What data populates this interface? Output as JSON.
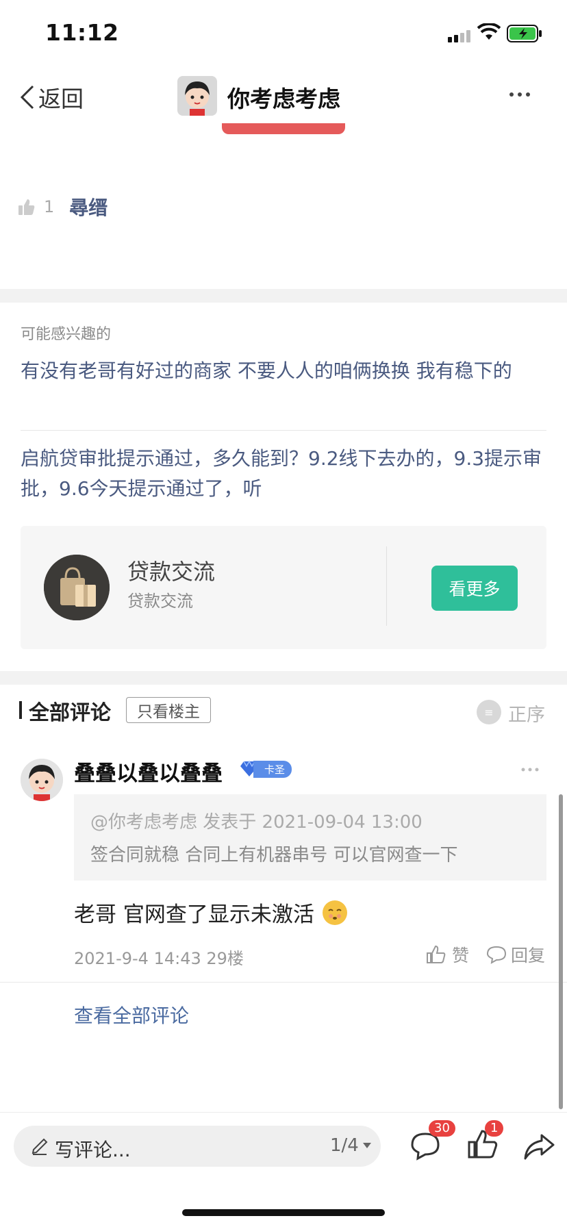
{
  "status_bar": {
    "time": "11:12"
  },
  "nav": {
    "back_label": "返回",
    "title": "你考虑考虑"
  },
  "likes": {
    "count": "1",
    "name": "尋缙"
  },
  "interest": {
    "label": "可能感兴趣的",
    "items": [
      "有没有老哥有好过的商家 不要人人的咱俩换换 我有稳下的",
      "启航贷审批提示通过，多久能到？9.2线下去办的，9.3提示审批，9.6今天提示通过了，听"
    ]
  },
  "group_card": {
    "name": "贷款交流",
    "subtitle": "贷款交流",
    "button": "看更多"
  },
  "comments": {
    "title": "全部评论",
    "only_owner": "只看楼主",
    "order_label": "正序",
    "item": {
      "name": "叠叠以叠以叠叠",
      "badge": "卡圣",
      "quote_header": "@你考虑考虑 发表于 2021-09-04 13:00",
      "quote_text": "签合同就稳 合同上有机器串号 可以官网查一下",
      "body": "老哥 官网查了显示未激活",
      "meta": "2021-9-4 14:43  29楼",
      "like_label": "赞",
      "reply_label": "回复"
    },
    "see_all": "查看全部评论"
  },
  "bottom_bar": {
    "input_placeholder": "写评论...",
    "page_indicator": "1/4",
    "comment_count": "30",
    "like_count": "1"
  },
  "colors": {
    "accent_green": "#2fbf9a",
    "link_blue": "#4a5a80",
    "badge_red": "#e8413f"
  }
}
